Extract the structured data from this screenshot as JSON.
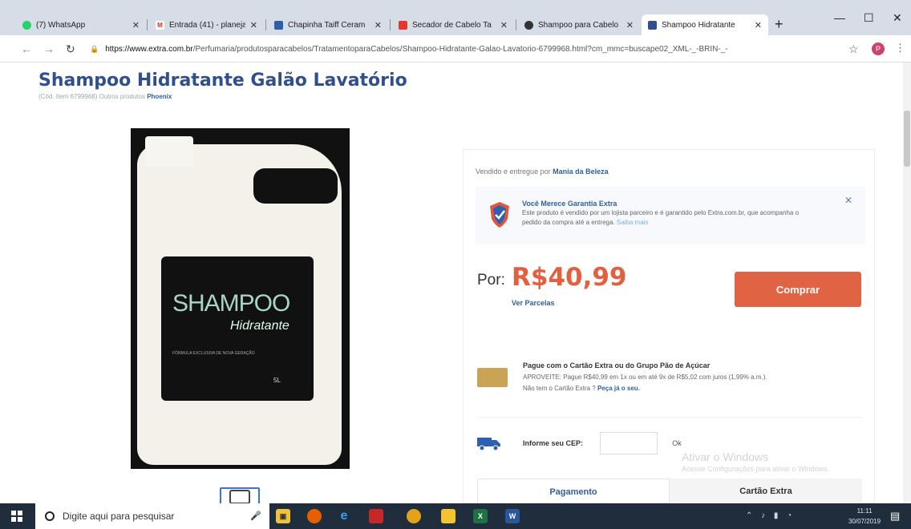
{
  "browser": {
    "tabs": [
      {
        "title": "(7) WhatsApp",
        "icon": "whatsapp-icon",
        "color": "#25d366",
        "glyph": ""
      },
      {
        "title": "Entrada (41) - planejar",
        "icon": "gmail-icon",
        "color": "#d93025",
        "glyph": "M"
      },
      {
        "title": "Chapinha Taiff Ceram",
        "icon": "store-icon",
        "color": "#2d5fa8",
        "glyph": ""
      },
      {
        "title": "Secador de Cabelo Ta",
        "icon": "store-icon",
        "color": "#e03a2e",
        "glyph": ""
      },
      {
        "title": "Shampoo para Cabelo",
        "icon": "shopping-icon",
        "color": "#333333",
        "glyph": ""
      },
      {
        "title": "Shampoo Hidratante",
        "icon": "extra-icon",
        "color": "#2f4f8f",
        "glyph": ""
      }
    ],
    "url_domain": "https://www.extra.com.br",
    "url_path": "/Perfumaria/produtosparacabelos/TratamentoparaCabelos/Shampoo-Hidratante-Galao-Lavatorio-6799968.html?cm_mmc=buscape02_XML-_-BRIN-_-",
    "profile_initial": "P",
    "window_controls": {
      "minimize": "—",
      "maximize": "☐",
      "close": "✕"
    },
    "new_tab": "+"
  },
  "product": {
    "title": "Shampoo Hidratante Galão Lavatório",
    "code_text": "(Cód. Item 6799968)   Outros produtos",
    "brand": "Phoenix",
    "label_main": "SHAMPOO",
    "label_sub": "Hidratante",
    "label_small": "FÓRMULA EXCLUSIVA DE NOVA GERAÇÃO",
    "label_volume": "5L"
  },
  "buybox": {
    "seller_prefix": "Vendido e entregue por",
    "seller_name": "Mania da Beleza",
    "guarantee_title": "Você Merece Garantia Extra",
    "guarantee_text": "Este produto é vendido por um lojista parceiro e é garantido pelo Extra.com.br, que acompanha o pedido da compra até a entrega.",
    "guarantee_link": "Saiba mais",
    "price_label": "Por:",
    "price": "R$40,99",
    "installments_link": "Ver Parcelas",
    "buy_button": "Comprar",
    "card_title": "Pague com o Cartão Extra ou do Grupo Pão de Açúcar",
    "card_line1": "APROVEITE: Pague R$40,99 em 1x ou em até 9x de R$5,02 com juros (1,99% a.m.).",
    "card_line2": "Não tem o Cartão Extra ?",
    "card_link": "Peça já o seu.",
    "cep_label": "Informe seu CEP:",
    "cep_ok": "Ok",
    "tab_payment": "Pagamento",
    "tab_card": "Cartão Extra",
    "colors": {
      "price": "#e35f3e",
      "buy": "#e06443",
      "link": "#3060a0"
    }
  },
  "os": {
    "watermark_title": "Ativar o Windows",
    "watermark_sub": "Acesse Configurações para ativar o Windows.",
    "search_placeholder": "Digite aqui para pesquisar",
    "time": "11:11",
    "date": "30/07/2019"
  }
}
